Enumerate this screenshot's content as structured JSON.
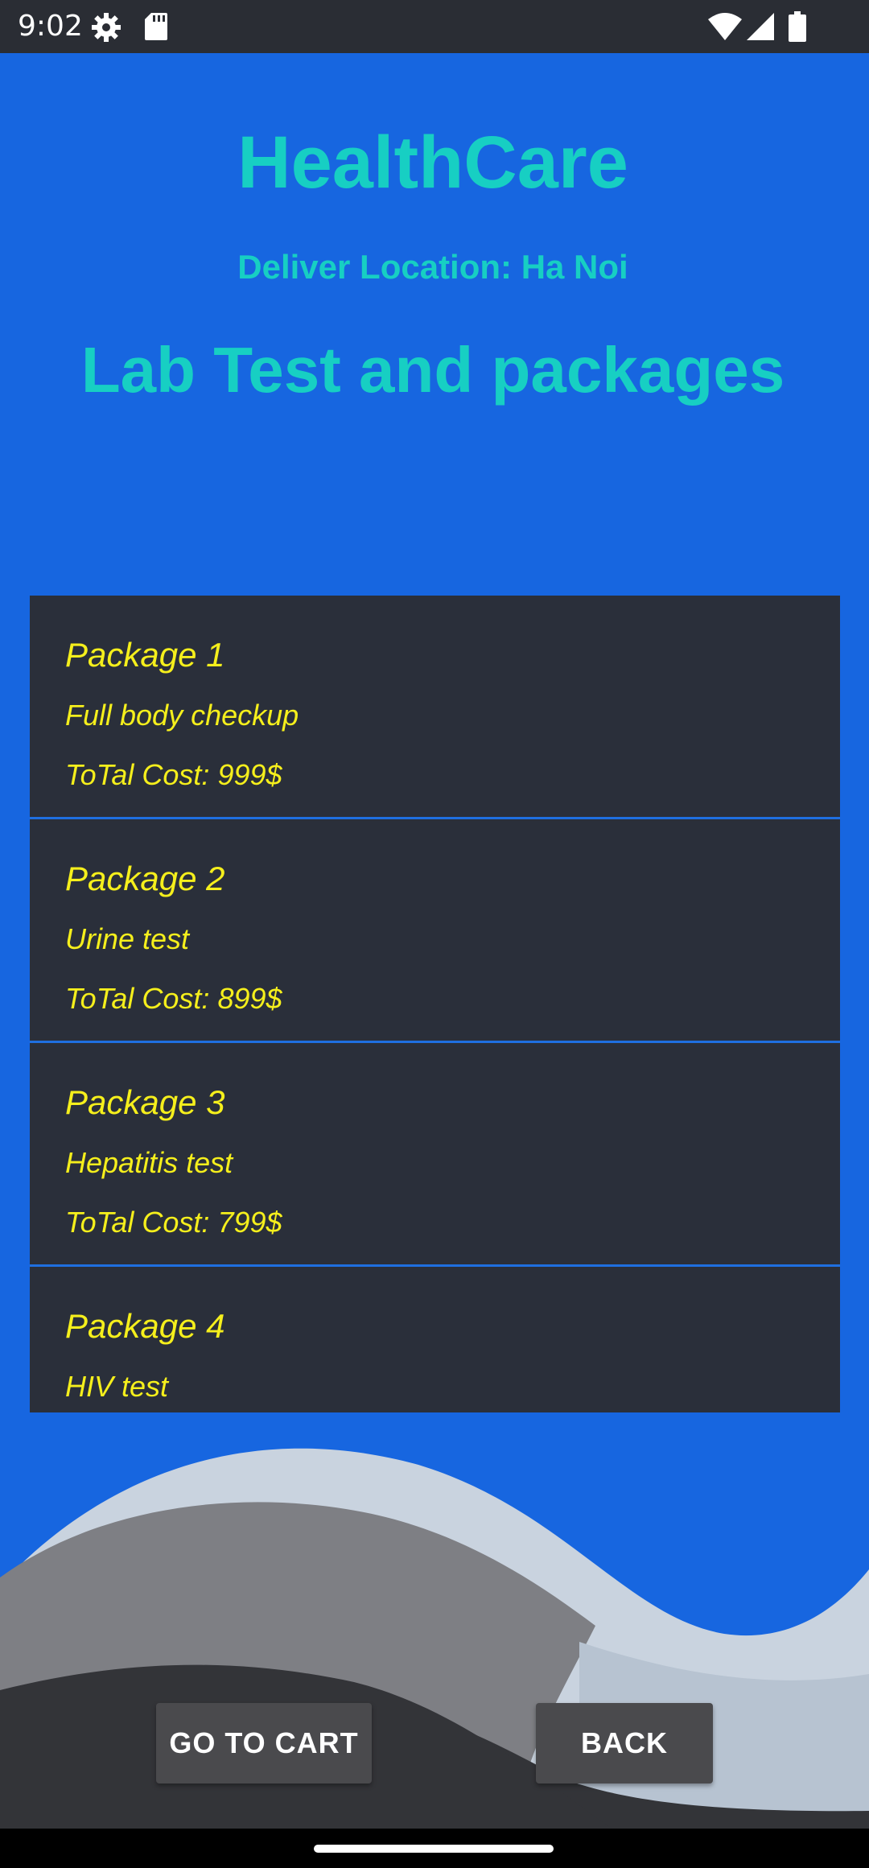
{
  "status_bar": {
    "time": "9:02",
    "icons": [
      "settings-gear-icon",
      "sd-card-icon",
      "wifi-icon",
      "cellular-signal-icon",
      "battery-icon"
    ]
  },
  "header": {
    "app_title": "HealthCare",
    "location": "Deliver Location: Ha Noi",
    "page_title": "Lab Test and packages"
  },
  "packages": [
    {
      "name": "Package 1",
      "description": "Full body checkup",
      "cost": "ToTal Cost: 999$"
    },
    {
      "name": "Package 2",
      "description": "Urine test",
      "cost": "ToTal Cost: 899$"
    },
    {
      "name": "Package 3",
      "description": "Hepatitis test",
      "cost": "ToTal Cost: 799$"
    },
    {
      "name": "Package 4",
      "description": "HIV test",
      "cost": ""
    }
  ],
  "buttons": {
    "go_to_cart": "GO TO CART",
    "back": "BACK"
  },
  "colors": {
    "background": "#1766e0",
    "title_text": "#17cfc3",
    "list_background": "#2a2f3a",
    "list_text": "#f5ef1c",
    "button_background": "#4a4a4d"
  }
}
